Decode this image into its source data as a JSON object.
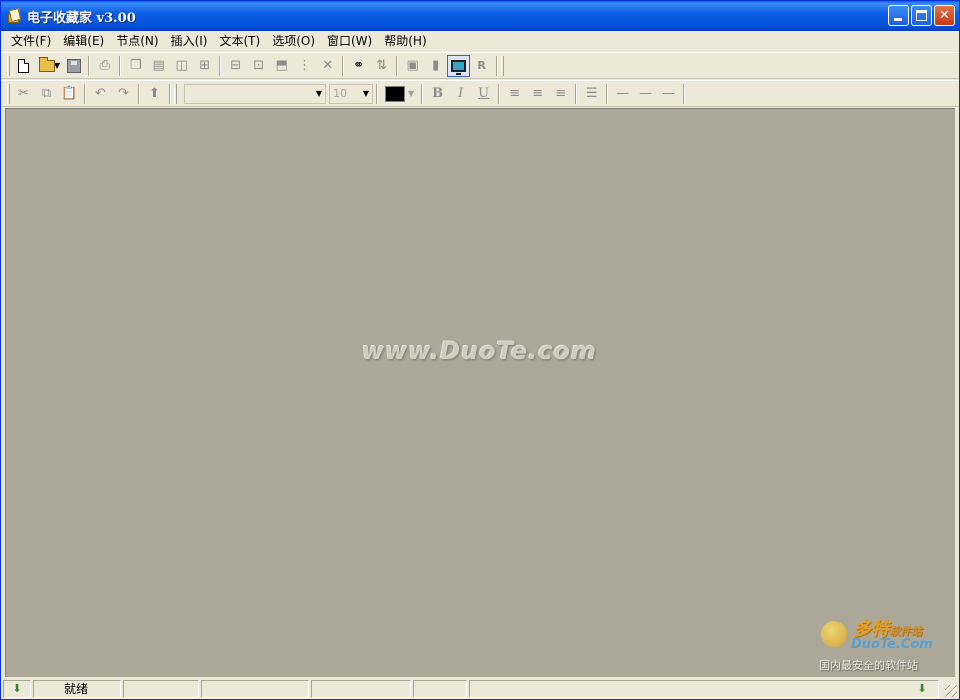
{
  "window": {
    "title": "电子收藏家  v3.00"
  },
  "menubar": {
    "items": [
      {
        "label": "文件(F)"
      },
      {
        "label": "编辑(E)"
      },
      {
        "label": "节点(N)"
      },
      {
        "label": "插入(I)"
      },
      {
        "label": "文本(T)"
      },
      {
        "label": "选项(O)"
      },
      {
        "label": "窗口(W)"
      },
      {
        "label": "帮助(H)"
      }
    ]
  },
  "toolbar1": {
    "icons": [
      "new-file-icon",
      "open-folder-icon",
      "save-disk-icon",
      "print-icon",
      "node-layers-icon",
      "split-horizontal-icon",
      "split-vertical-icon",
      "grid-icon",
      "tree-collapse-icon",
      "tree-expand-icon",
      "node-up-icon",
      "node-move-icon",
      "delete-icon",
      "find-binoculars-icon",
      "sort-icon",
      "window-icon",
      "book-icon",
      "monitor-icon",
      "r-icon"
    ],
    "r_label": "R"
  },
  "toolbar2": {
    "font_name": "",
    "font_size": "10",
    "text_color": "#000000",
    "bold_label": "B",
    "italic_label": "I",
    "underline_label": "U"
  },
  "client": {
    "background": "#aba89a",
    "watermark": "www.DuoTe.com"
  },
  "corner_logo": {
    "brand_cn": "多特",
    "brand_cn_small": "软件站",
    "brand_en": "DuoTe.Com",
    "tagline": "国内最安全的软件站"
  },
  "statusbar": {
    "status_text": "就绪"
  }
}
